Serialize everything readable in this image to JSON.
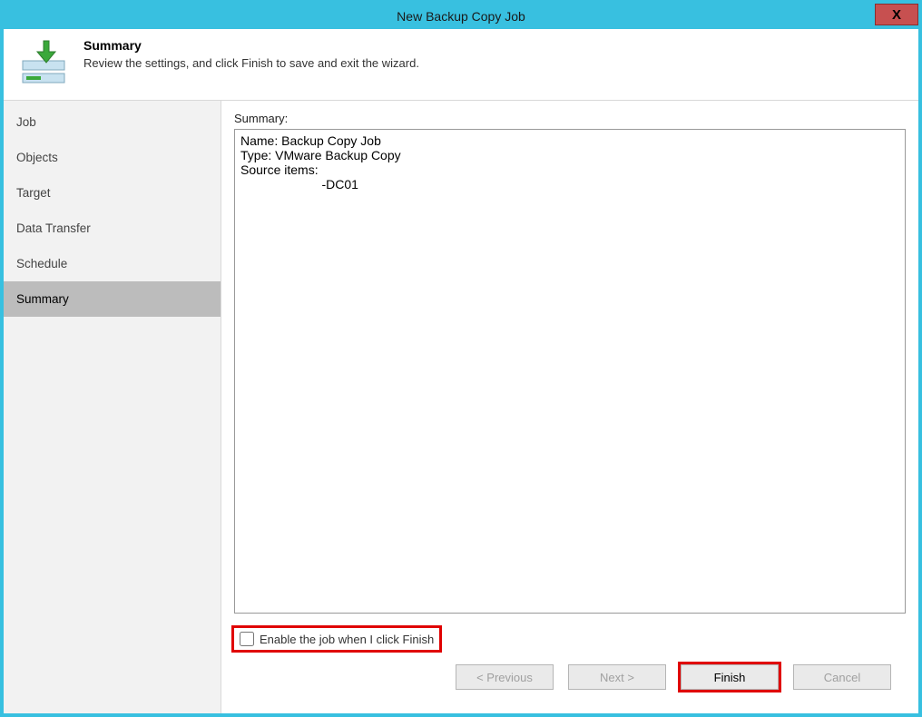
{
  "window": {
    "title": "New Backup Copy Job"
  },
  "header": {
    "heading": "Summary",
    "subheading": "Review the settings, and click Finish to save and exit the wizard."
  },
  "sidebar": {
    "items": [
      {
        "label": "Job",
        "active": false
      },
      {
        "label": "Objects",
        "active": false
      },
      {
        "label": "Target",
        "active": false
      },
      {
        "label": "Data Transfer",
        "active": false
      },
      {
        "label": "Schedule",
        "active": false
      },
      {
        "label": "Summary",
        "active": true
      }
    ]
  },
  "main": {
    "summary_label": "Summary:",
    "summary_text": "Name: Backup Copy Job\nType: VMware Backup Copy\nSource items:\n                       -DC01",
    "enable_checkbox_label": "Enable the job when I click Finish",
    "enable_checkbox_checked": false
  },
  "footer": {
    "previous_label": "< Previous",
    "next_label": "Next >",
    "finish_label": "Finish",
    "cancel_label": "Cancel"
  }
}
